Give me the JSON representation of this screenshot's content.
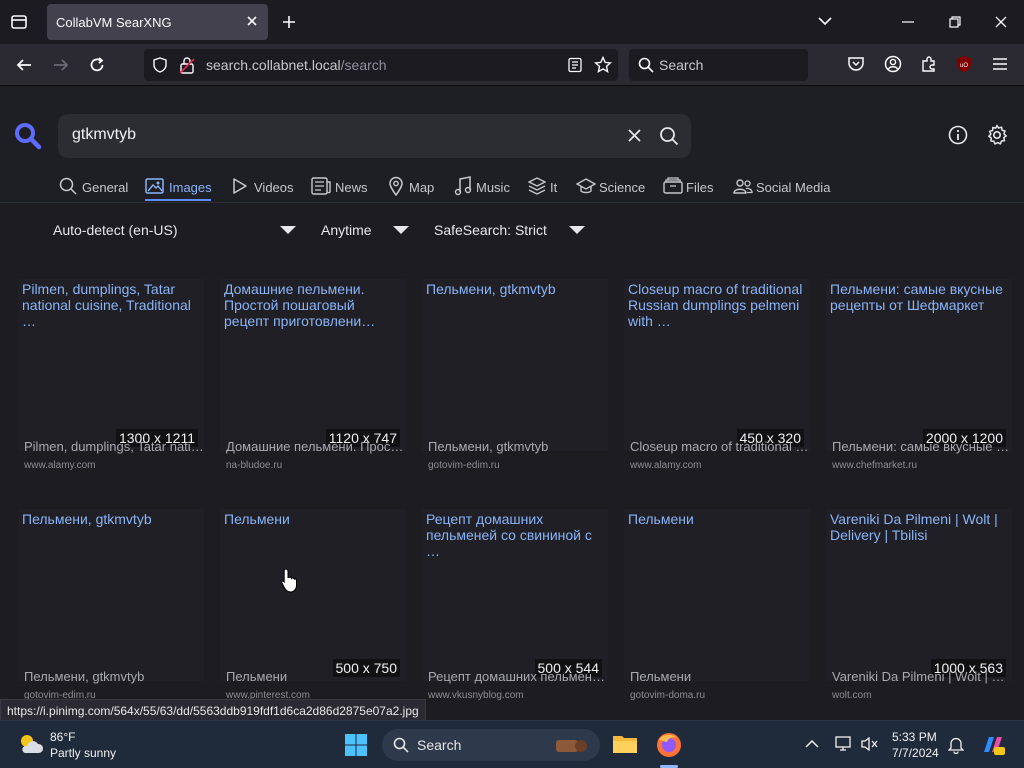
{
  "browser": {
    "tab_title": "CollabVM SearXNG",
    "url_host": "search.collabnet.local",
    "url_path": "/search",
    "search_placeholder": "Search"
  },
  "search": {
    "query": "gtkmvtyb",
    "categories": [
      {
        "label": "General",
        "icon": "search-icon"
      },
      {
        "label": "Images",
        "icon": "image-icon",
        "active": true
      },
      {
        "label": "Videos",
        "icon": "play-icon"
      },
      {
        "label": "News",
        "icon": "newspaper-icon"
      },
      {
        "label": "Map",
        "icon": "map-pin-icon"
      },
      {
        "label": "Music",
        "icon": "music-note-icon"
      },
      {
        "label": "It",
        "icon": "layers-icon"
      },
      {
        "label": "Science",
        "icon": "graduation-cap-icon"
      },
      {
        "label": "Files",
        "icon": "files-icon"
      },
      {
        "label": "Social Media",
        "icon": "people-icon"
      }
    ],
    "filters": {
      "language": "Auto-detect (en-US)",
      "time": "Anytime",
      "safesearch": "SafeSearch: Strict"
    }
  },
  "results": [
    {
      "title": "Pilmen, dumplings, Tatar national cuisine, Traditional …",
      "dims": "1300 x 1211",
      "caption": "Pilmen, dumplings, Tatar national cuisine",
      "domain": "www.alamy.com"
    },
    {
      "title": "Домашние пельмени. Простой пошаговый рецепт приготовлени…",
      "dims": "1120 x 747",
      "caption": "Домашние пельмени. Простой пошаговый рецепт",
      "domain": "na-bludoe.ru"
    },
    {
      "title": "Пельмени, gtkmvtyb",
      "dims": "",
      "caption": "Пельмени, gtkmvtyb",
      "domain": "gotovim-edim.ru"
    },
    {
      "title": "Closeup macro of traditional Russian dumplings pelmeni with …",
      "dims": "450 x 320",
      "caption": "Closeup macro of traditional Russian dumplings",
      "domain": "www.alamy.com"
    },
    {
      "title": "Пельмени: самые вкусные рецепты от Шефмаркет",
      "dims": "2000 x 1200",
      "caption": "Пельмени: самые вкусные рецепты от Шефмаркет",
      "domain": "www.chefmarket.ru"
    },
    {
      "title": "Пельмени, gtkmvtyb",
      "dims": "",
      "caption": "Пельмени, gtkmvtyb",
      "domain": "gotovim-edim.ru"
    },
    {
      "title": "Пельмени",
      "dims": "500 x 750",
      "caption": "Пельмени",
      "domain": "www.pinterest.com"
    },
    {
      "title": "Рецепт домашних пельменей со свининой с …",
      "dims": "500 x 544",
      "caption": "Рецепт домашних пельменей со свининой",
      "domain": "www.vkusnyblog.com"
    },
    {
      "title": "Пельмени",
      "dims": "",
      "caption": "Пельмени",
      "domain": "gotovim-doma.ru"
    },
    {
      "title": "Vareniki Da Pilmeni | Wolt | Delivery | Tbilisi",
      "dims": "1000 x 563",
      "caption": "Vareniki Da Pilmeni | Wolt | Delivery | Tbilisi",
      "domain": "wolt.com"
    }
  ],
  "status_url": "https://i.pinimg.com/564x/55/63/dd/5563ddb919fdf1d6ca2d86d2875e07a2.jpg",
  "taskbar": {
    "temperature": "86°F",
    "weather": "Partly sunny",
    "search_label": "Search",
    "time": "5:33 PM",
    "date": "7/7/2024"
  },
  "colors": {
    "accent": "#8ab4f8",
    "logo": "#5e6bff",
    "page_bg": "#1c1c21",
    "taskbar_bg": "#1f2a3a"
  }
}
